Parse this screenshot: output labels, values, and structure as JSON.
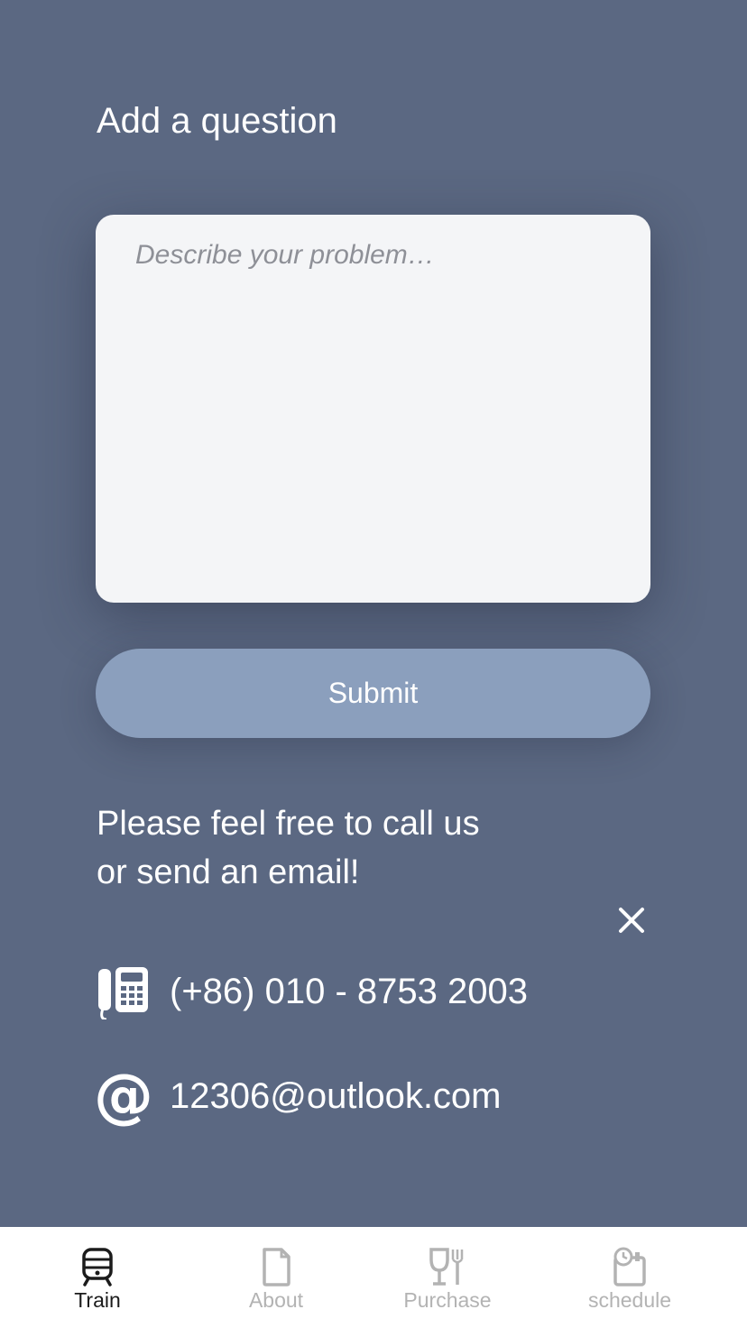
{
  "header": {
    "title": "Add a question"
  },
  "question": {
    "value": "",
    "placeholder": "Describe your problem…"
  },
  "submit": {
    "label": "Submit"
  },
  "contact": {
    "line1": "Please feel free to call us",
    "line2": "or send an email!",
    "phone": "(+86) 010 - 8753 2003",
    "email": "12306@outlook.com",
    "phone_icon": "telephone-icon",
    "email_icon": "at-sign-icon",
    "email_icon_glyph": "@"
  },
  "tabs": [
    {
      "label": "Train",
      "icon": "train-icon",
      "active": true
    },
    {
      "label": "About",
      "icon": "document-icon",
      "active": false
    },
    {
      "label": "Purchase",
      "icon": "dining-icon",
      "active": false
    },
    {
      "label": "schedule",
      "icon": "calendar-clock-icon",
      "active": false
    }
  ],
  "colors": {
    "background": "#5b6882",
    "input_bg": "#f4f5f7",
    "button": "#8b9fbd",
    "tab_active": "#1b1b1b",
    "tab_inactive": "#b3b3b3"
  }
}
